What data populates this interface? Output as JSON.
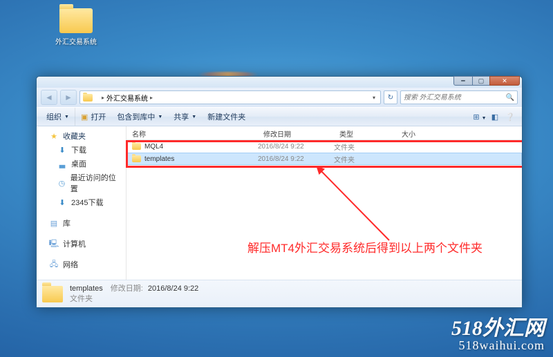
{
  "desktop": {
    "icon_label": "外汇交易系统"
  },
  "window": {
    "breadcrumb": {
      "root": "外汇交易系统"
    },
    "search_placeholder": "搜索 外汇交易系统"
  },
  "toolbar": {
    "organize": "组织",
    "open": "打开",
    "include": "包含到库中",
    "share": "共享",
    "newfolder": "新建文件夹"
  },
  "sidebar": {
    "favorites": "收藏夹",
    "downloads": "下载",
    "desktop": "桌面",
    "recent": "最近访问的位置",
    "custom_dl": "2345下载",
    "libraries": "库",
    "computer": "计算机",
    "network": "网络"
  },
  "columns": {
    "name": "名称",
    "date": "修改日期",
    "type": "类型",
    "size": "大小"
  },
  "rows": [
    {
      "name": "MQL4",
      "date": "2016/8/24 9:22",
      "type": "文件夹",
      "selected": false
    },
    {
      "name": "templates",
      "date": "2016/8/24 9:22",
      "type": "文件夹",
      "selected": true
    }
  ],
  "annotation": {
    "text": "解压MT4外汇交易系统后得到以上两个文件夹"
  },
  "statusbar": {
    "name": "templates",
    "date_label": "修改日期:",
    "date": "2016/8/24 9:22",
    "type": "文件夹"
  },
  "watermark": {
    "line1_prefix": "518",
    "line1_suffix": "外汇网",
    "line2": "518waihui.com"
  }
}
